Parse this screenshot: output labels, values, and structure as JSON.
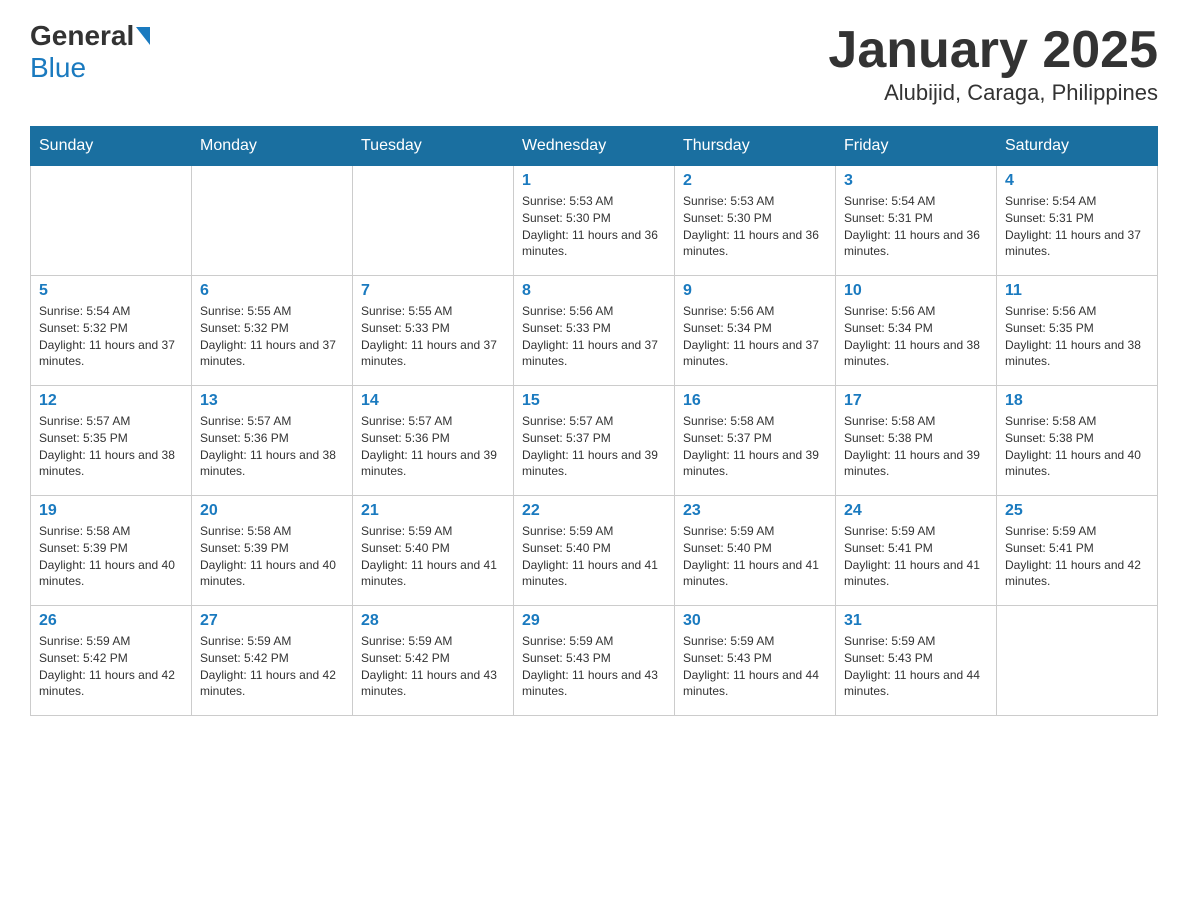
{
  "header": {
    "logo_general": "General",
    "logo_blue": "Blue",
    "month_title": "January 2025",
    "location": "Alubijid, Caraga, Philippines"
  },
  "days_of_week": [
    "Sunday",
    "Monday",
    "Tuesday",
    "Wednesday",
    "Thursday",
    "Friday",
    "Saturday"
  ],
  "weeks": [
    [
      null,
      null,
      null,
      {
        "day": 1,
        "sunrise": "Sunrise: 5:53 AM",
        "sunset": "Sunset: 5:30 PM",
        "daylight": "Daylight: 11 hours and 36 minutes."
      },
      {
        "day": 2,
        "sunrise": "Sunrise: 5:53 AM",
        "sunset": "Sunset: 5:30 PM",
        "daylight": "Daylight: 11 hours and 36 minutes."
      },
      {
        "day": 3,
        "sunrise": "Sunrise: 5:54 AM",
        "sunset": "Sunset: 5:31 PM",
        "daylight": "Daylight: 11 hours and 36 minutes."
      },
      {
        "day": 4,
        "sunrise": "Sunrise: 5:54 AM",
        "sunset": "Sunset: 5:31 PM",
        "daylight": "Daylight: 11 hours and 37 minutes."
      }
    ],
    [
      {
        "day": 5,
        "sunrise": "Sunrise: 5:54 AM",
        "sunset": "Sunset: 5:32 PM",
        "daylight": "Daylight: 11 hours and 37 minutes."
      },
      {
        "day": 6,
        "sunrise": "Sunrise: 5:55 AM",
        "sunset": "Sunset: 5:32 PM",
        "daylight": "Daylight: 11 hours and 37 minutes."
      },
      {
        "day": 7,
        "sunrise": "Sunrise: 5:55 AM",
        "sunset": "Sunset: 5:33 PM",
        "daylight": "Daylight: 11 hours and 37 minutes."
      },
      {
        "day": 8,
        "sunrise": "Sunrise: 5:56 AM",
        "sunset": "Sunset: 5:33 PM",
        "daylight": "Daylight: 11 hours and 37 minutes."
      },
      {
        "day": 9,
        "sunrise": "Sunrise: 5:56 AM",
        "sunset": "Sunset: 5:34 PM",
        "daylight": "Daylight: 11 hours and 37 minutes."
      },
      {
        "day": 10,
        "sunrise": "Sunrise: 5:56 AM",
        "sunset": "Sunset: 5:34 PM",
        "daylight": "Daylight: 11 hours and 38 minutes."
      },
      {
        "day": 11,
        "sunrise": "Sunrise: 5:56 AM",
        "sunset": "Sunset: 5:35 PM",
        "daylight": "Daylight: 11 hours and 38 minutes."
      }
    ],
    [
      {
        "day": 12,
        "sunrise": "Sunrise: 5:57 AM",
        "sunset": "Sunset: 5:35 PM",
        "daylight": "Daylight: 11 hours and 38 minutes."
      },
      {
        "day": 13,
        "sunrise": "Sunrise: 5:57 AM",
        "sunset": "Sunset: 5:36 PM",
        "daylight": "Daylight: 11 hours and 38 minutes."
      },
      {
        "day": 14,
        "sunrise": "Sunrise: 5:57 AM",
        "sunset": "Sunset: 5:36 PM",
        "daylight": "Daylight: 11 hours and 39 minutes."
      },
      {
        "day": 15,
        "sunrise": "Sunrise: 5:57 AM",
        "sunset": "Sunset: 5:37 PM",
        "daylight": "Daylight: 11 hours and 39 minutes."
      },
      {
        "day": 16,
        "sunrise": "Sunrise: 5:58 AM",
        "sunset": "Sunset: 5:37 PM",
        "daylight": "Daylight: 11 hours and 39 minutes."
      },
      {
        "day": 17,
        "sunrise": "Sunrise: 5:58 AM",
        "sunset": "Sunset: 5:38 PM",
        "daylight": "Daylight: 11 hours and 39 minutes."
      },
      {
        "day": 18,
        "sunrise": "Sunrise: 5:58 AM",
        "sunset": "Sunset: 5:38 PM",
        "daylight": "Daylight: 11 hours and 40 minutes."
      }
    ],
    [
      {
        "day": 19,
        "sunrise": "Sunrise: 5:58 AM",
        "sunset": "Sunset: 5:39 PM",
        "daylight": "Daylight: 11 hours and 40 minutes."
      },
      {
        "day": 20,
        "sunrise": "Sunrise: 5:58 AM",
        "sunset": "Sunset: 5:39 PM",
        "daylight": "Daylight: 11 hours and 40 minutes."
      },
      {
        "day": 21,
        "sunrise": "Sunrise: 5:59 AM",
        "sunset": "Sunset: 5:40 PM",
        "daylight": "Daylight: 11 hours and 41 minutes."
      },
      {
        "day": 22,
        "sunrise": "Sunrise: 5:59 AM",
        "sunset": "Sunset: 5:40 PM",
        "daylight": "Daylight: 11 hours and 41 minutes."
      },
      {
        "day": 23,
        "sunrise": "Sunrise: 5:59 AM",
        "sunset": "Sunset: 5:40 PM",
        "daylight": "Daylight: 11 hours and 41 minutes."
      },
      {
        "day": 24,
        "sunrise": "Sunrise: 5:59 AM",
        "sunset": "Sunset: 5:41 PM",
        "daylight": "Daylight: 11 hours and 41 minutes."
      },
      {
        "day": 25,
        "sunrise": "Sunrise: 5:59 AM",
        "sunset": "Sunset: 5:41 PM",
        "daylight": "Daylight: 11 hours and 42 minutes."
      }
    ],
    [
      {
        "day": 26,
        "sunrise": "Sunrise: 5:59 AM",
        "sunset": "Sunset: 5:42 PM",
        "daylight": "Daylight: 11 hours and 42 minutes."
      },
      {
        "day": 27,
        "sunrise": "Sunrise: 5:59 AM",
        "sunset": "Sunset: 5:42 PM",
        "daylight": "Daylight: 11 hours and 42 minutes."
      },
      {
        "day": 28,
        "sunrise": "Sunrise: 5:59 AM",
        "sunset": "Sunset: 5:42 PM",
        "daylight": "Daylight: 11 hours and 43 minutes."
      },
      {
        "day": 29,
        "sunrise": "Sunrise: 5:59 AM",
        "sunset": "Sunset: 5:43 PM",
        "daylight": "Daylight: 11 hours and 43 minutes."
      },
      {
        "day": 30,
        "sunrise": "Sunrise: 5:59 AM",
        "sunset": "Sunset: 5:43 PM",
        "daylight": "Daylight: 11 hours and 44 minutes."
      },
      {
        "day": 31,
        "sunrise": "Sunrise: 5:59 AM",
        "sunset": "Sunset: 5:43 PM",
        "daylight": "Daylight: 11 hours and 44 minutes."
      },
      null
    ]
  ]
}
